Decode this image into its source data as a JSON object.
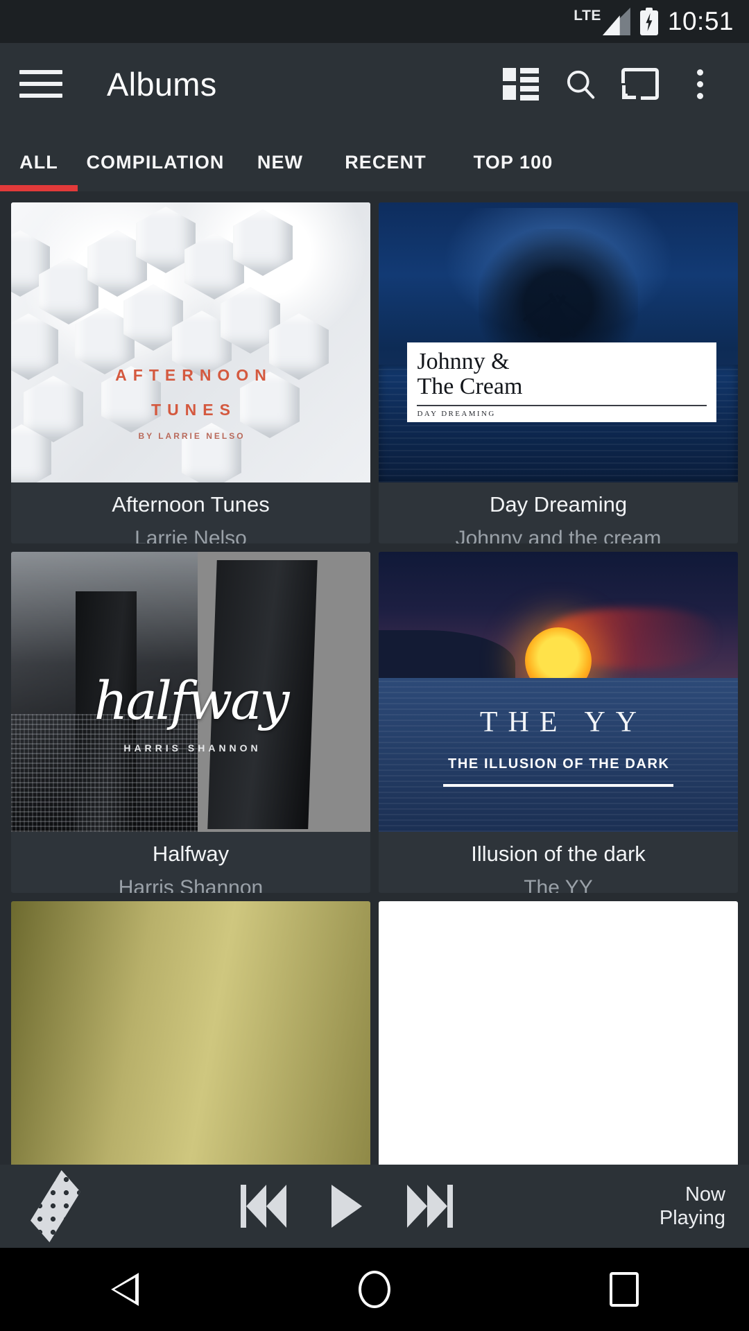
{
  "status_bar": {
    "network_label": "LTE",
    "time": "10:51",
    "signal_icon": "signal-bars-icon",
    "battery_icon": "battery-charging-icon"
  },
  "toolbar": {
    "menu_icon": "hamburger-menu-icon",
    "title": "Albums",
    "view_mode_icon": "list-view-icon",
    "search_icon": "search-icon",
    "cast_icon": "cast-icon",
    "overflow_icon": "more-vert-icon"
  },
  "tabs": {
    "items": [
      {
        "label": "ALL",
        "active": true
      },
      {
        "label": "COMPILATION",
        "active": false
      },
      {
        "label": "NEW",
        "active": false
      },
      {
        "label": "RECENT",
        "active": false
      },
      {
        "label": "TOP 100",
        "active": false
      }
    ],
    "indicator_color": "#e23a3a"
  },
  "albums": [
    {
      "title": "Afternoon Tunes",
      "artist": "Larrie Nelso",
      "cover": {
        "style": "hexagon-white",
        "line1": "AFTERNOON",
        "line2": "TUNES",
        "line3": "BY LARRIE NELSO"
      }
    },
    {
      "title": "Day Dreaming",
      "artist": "Johnny and the cream",
      "cover": {
        "style": "night-tree-blue",
        "line1": "Johnny &",
        "line2": "The Cream",
        "line3": "DAY DREAMING"
      }
    },
    {
      "title": "Halfway",
      "artist": "Harris Shannon",
      "cover": {
        "style": "bw-city-split",
        "line1": "halfway",
        "line2": "HARRIS SHANNON"
      }
    },
    {
      "title": "Illusion of the dark",
      "artist": "The YY",
      "cover": {
        "style": "sunset-ocean",
        "line1": "THE YY",
        "line2": "THE ILLUSION OF THE DARK"
      }
    }
  ],
  "partial_row": [
    {
      "cover": {
        "style": "olive-gradient"
      }
    },
    {
      "cover": {
        "style": "white-plain"
      }
    }
  ],
  "player": {
    "equalizer_icon": "equalizer-grid-icon",
    "previous_icon": "skip-previous-icon",
    "play_icon": "play-icon",
    "next_icon": "skip-next-icon",
    "now_playing_line1": "Now",
    "now_playing_line2": "Playing"
  },
  "nav_bar": {
    "back_icon": "back-triangle-icon",
    "home_icon": "home-circle-icon",
    "recents_icon": "recents-square-icon"
  },
  "colors": {
    "app_background": "#272c31",
    "toolbar_background": "#2c3237",
    "status_background": "#1c2023",
    "card_background": "#2e343a",
    "accent": "#e23a3a",
    "primary_text": "#f2f4f6",
    "secondary_text": "#9aa1a8"
  }
}
